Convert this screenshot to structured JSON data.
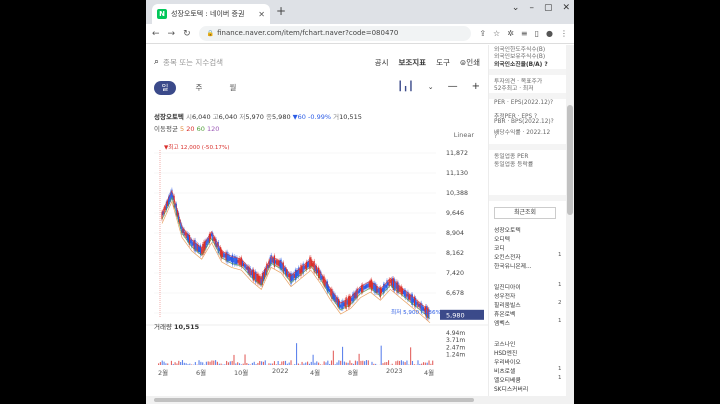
{
  "browser": {
    "tab_title": "성장오토텍 : 네이버 증권",
    "favicon": "N",
    "url": "finance.naver.com/item/fchart.naver?code=080470"
  },
  "search": {
    "placeholder": "종목 또는 지수검색"
  },
  "top_menu": [
    "공시",
    "보조지표",
    "도구",
    "⊜인쇄"
  ],
  "periods": [
    "일",
    "주",
    "월"
  ],
  "selected_period": "일",
  "quote": {
    "name": "성장오토텍",
    "open_label": "시",
    "open": "6,040",
    "high_label": "고",
    "high": "6,040",
    "low_label": "저",
    "low": "5,970",
    "close_label": "종",
    "close": "5,980",
    "change": "▼60",
    "change_pct": "-0.99%",
    "volume_label": "거",
    "volume": "10,515"
  },
  "moving_average": {
    "label": "이동평균",
    "m5": "5",
    "m20": "20",
    "m60": "60",
    "m120": "120"
  },
  "scale_mode": "Linear",
  "chart_labels": {
    "max_marker": "최고 12,000 (-50.17%)",
    "min_marker": "최저 5,900 (1.36%)",
    "current_price": "5,980"
  },
  "volume_header": {
    "label": "거래량",
    "value": "10,515"
  },
  "colors": {
    "up": "#d9302c",
    "down": "#2b5ce6",
    "accent": "#3b4a8a"
  },
  "chart_data": {
    "type": "line",
    "x": [
      "2021-12",
      "2022-02",
      "2022-04",
      "2022-06",
      "2022-08",
      "2022-10",
      "2022-12",
      "2023-02",
      "2023-04"
    ],
    "x_tick_labels": [
      "2월",
      "6월",
      "10월",
      "2022",
      "4월",
      "8월",
      "2023",
      "4월"
    ],
    "y_tick_labels": [
      "11,872",
      "11,130",
      "10,388",
      "9,646",
      "8,904",
      "8,162",
      "7,420",
      "6,678",
      "5,980"
    ],
    "volume_tick_labels": [
      "4.94m",
      "3.71m",
      "2.47m",
      "1.24m"
    ],
    "series": [
      {
        "values": [
          9600,
          10400,
          9100,
          8600,
          8300,
          8900,
          8200,
          8000,
          7900,
          7500,
          7200,
          8000,
          7800,
          7300,
          7600,
          7900,
          7400,
          6800,
          6300,
          6500,
          6900,
          7100,
          6800,
          7200,
          6900,
          6600,
          6300,
          5980
        ]
      }
    ],
    "ylim": [
      5900,
      12100
    ],
    "volume_ylim": [
      0,
      4940000
    ]
  }
}
